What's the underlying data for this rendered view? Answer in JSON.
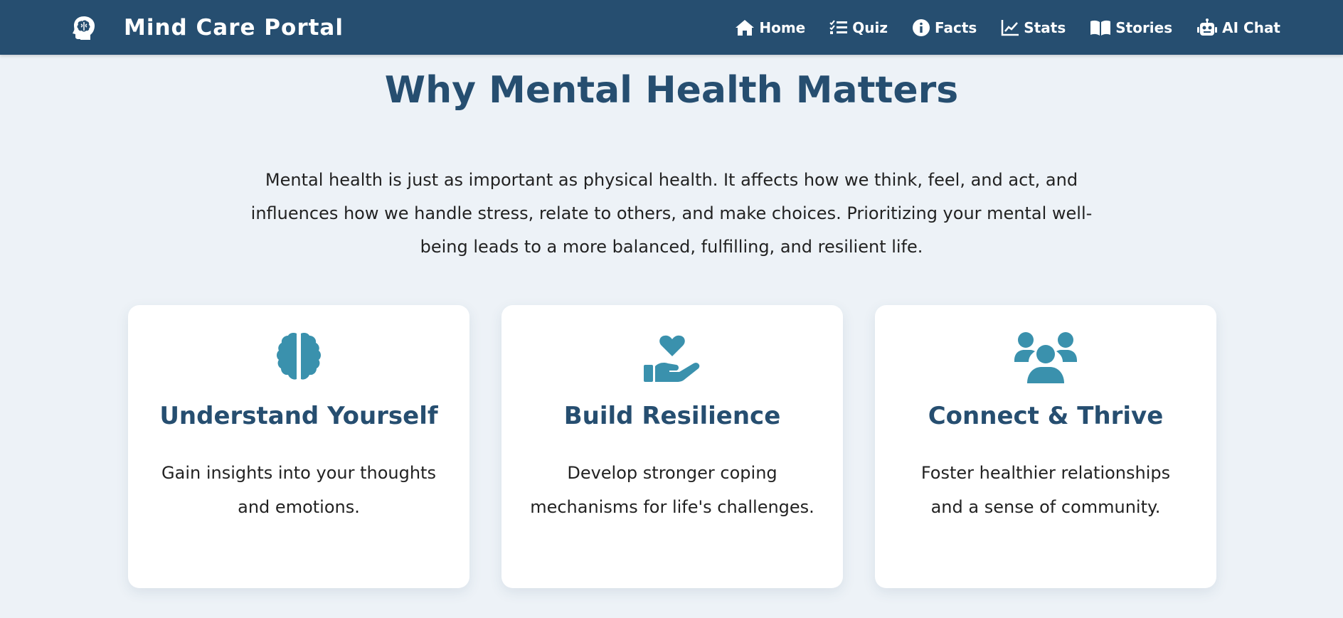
{
  "header": {
    "title": "Mind Care Portal",
    "logo_icon": "head-brain-icon",
    "nav": [
      {
        "label": "Home",
        "icon": "home-icon"
      },
      {
        "label": "Quiz",
        "icon": "list-check-icon"
      },
      {
        "label": "Facts",
        "icon": "info-circle-icon"
      },
      {
        "label": "Stats",
        "icon": "chart-line-icon"
      },
      {
        "label": "Stories",
        "icon": "book-open-icon"
      },
      {
        "label": "AI Chat",
        "icon": "robot-icon"
      }
    ]
  },
  "main": {
    "title": "Why Mental Health Matters",
    "intro": "Mental health is just as important as physical health. It affects how we think, feel, and act, and influences how we handle stress, relate to others, and make choices. Prioritizing your mental well-being leads to a more balanced, fulfilling, and resilient life.",
    "cards": [
      {
        "icon": "brain-icon",
        "title": "Understand Yourself",
        "text": "Gain insights into your thoughts and emotions."
      },
      {
        "icon": "hand-holding-heart-icon",
        "title": "Build Resilience",
        "text": "Develop stronger coping mechanisms for life's challenges."
      },
      {
        "icon": "users-icon",
        "title": "Connect & Thrive",
        "text": "Foster healthier relationships and a sense of community."
      }
    ]
  },
  "colors": {
    "navbar": "#264e70",
    "accent": "#3a91ad",
    "title": "#264e70",
    "background": "#edf2f7"
  }
}
